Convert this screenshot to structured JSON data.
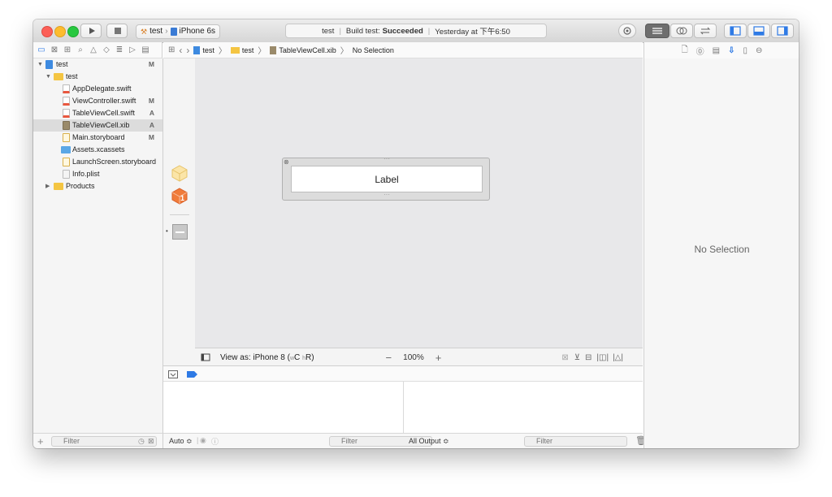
{
  "toolbar": {
    "scheme": "test",
    "device": "iPhone 6s",
    "activity_project": "test",
    "activity_build_prefix": "Build test:",
    "activity_status": "Succeeded",
    "activity_time": "Yesterday at 下午6:50"
  },
  "jumpbar": {
    "crumbs": [
      "test",
      "test",
      "TableViewCell.xib",
      "No Selection"
    ]
  },
  "navigator": {
    "items": [
      {
        "label": "test",
        "badge": "M"
      },
      {
        "label": "test",
        "badge": ""
      },
      {
        "label": "AppDelegate.swift",
        "badge": ""
      },
      {
        "label": "ViewController.swift",
        "badge": "M"
      },
      {
        "label": "TableViewCell.swift",
        "badge": "A"
      },
      {
        "label": "TableViewCell.xib",
        "badge": "A"
      },
      {
        "label": "Main.storyboard",
        "badge": "M"
      },
      {
        "label": "Assets.xcassets",
        "badge": ""
      },
      {
        "label": "LaunchScreen.storyboard",
        "badge": ""
      },
      {
        "label": "Info.plist",
        "badge": ""
      },
      {
        "label": "Products",
        "badge": ""
      }
    ],
    "filter_placeholder": "Filter"
  },
  "canvas": {
    "cell_label": "Label",
    "outline_badge": "1",
    "view_as": "View as: iPhone 8 (",
    "size_class_w": "w",
    "size_class_c": "C",
    "size_class_h": "h",
    "size_class_r": "R",
    "view_as_close": ")",
    "zoom": "100%"
  },
  "debug": {
    "auto_label": "Auto ≎",
    "filter_placeholder": "Filter",
    "output_label": "All Output ≎",
    "console_filter_placeholder": "Filter"
  },
  "inspector": {
    "no_selection": "No Selection"
  }
}
